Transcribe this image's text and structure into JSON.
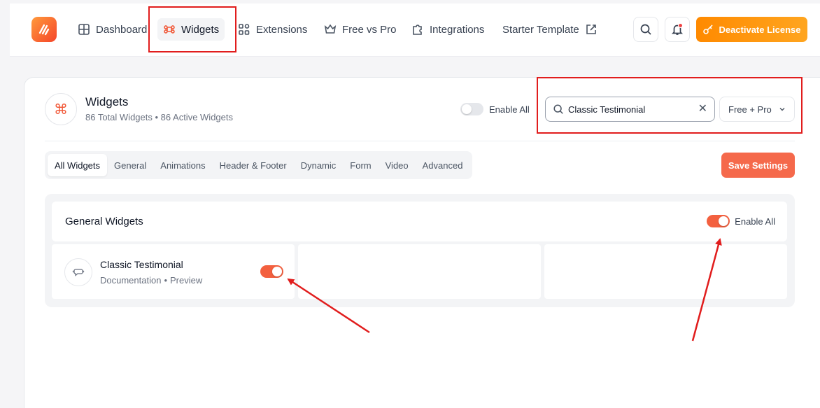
{
  "nav": {
    "items": [
      {
        "label": "Dashboard",
        "icon": "grid-icon"
      },
      {
        "label": "Widgets",
        "icon": "command-icon",
        "active": true
      },
      {
        "label": "Extensions",
        "icon": "extensions-icon"
      },
      {
        "label": "Free vs Pro",
        "icon": "crown-icon"
      },
      {
        "label": "Integrations",
        "icon": "puzzle-icon"
      },
      {
        "label": "Starter Template",
        "icon": "external-link-icon"
      }
    ],
    "deactivate_label": "Deactivate License"
  },
  "header": {
    "title": "Widgets",
    "total": "86 Total Widgets",
    "active": "86 Active Widgets",
    "enable_all_label": "Enable All",
    "enable_all_on": false
  },
  "search": {
    "value": "Classic Testimonial",
    "placeholder": "Search widgets"
  },
  "filter": {
    "selected": "Free + Pro"
  },
  "tabs": [
    {
      "label": "All Widgets",
      "active": true
    },
    {
      "label": "General"
    },
    {
      "label": "Animations"
    },
    {
      "label": "Header & Footer"
    },
    {
      "label": "Dynamic"
    },
    {
      "label": "Form"
    },
    {
      "label": "Video"
    },
    {
      "label": "Advanced"
    }
  ],
  "save_label": "Save Settings",
  "section": {
    "title": "General Widgets",
    "enable_all_label": "Enable All",
    "enable_all_on": true,
    "widgets": [
      {
        "name": "Classic Testimonial",
        "doc_label": "Documentation",
        "separator": "•",
        "preview_label": "Preview",
        "enabled": true
      }
    ]
  },
  "colors": {
    "accent": "#f3603f",
    "annotation": "#e11d1d",
    "deactivate": "#ff8a00"
  }
}
